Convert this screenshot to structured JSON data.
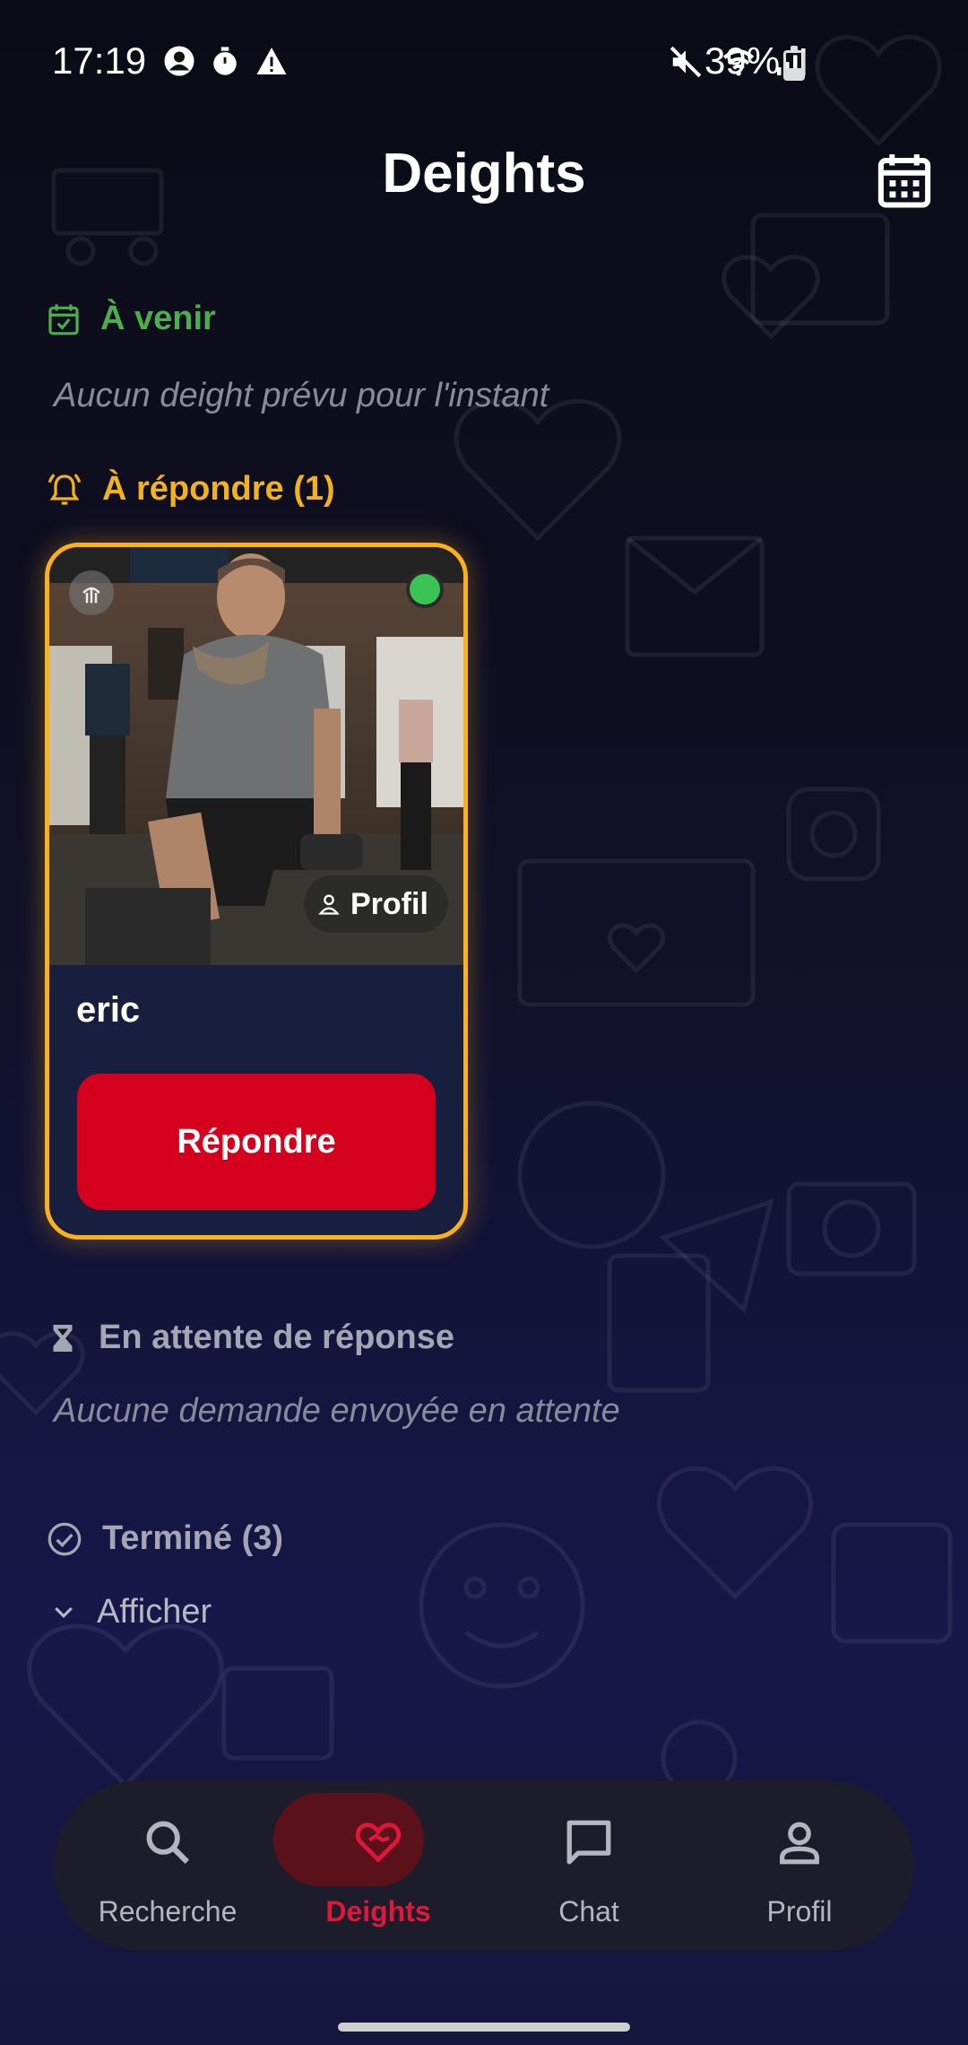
{
  "status_bar": {
    "time": "17:19",
    "battery": "39%",
    "battery_level": 0.39
  },
  "header": {
    "title": "Deights",
    "calendar_icon": "calendar-icon"
  },
  "sections": {
    "upcoming": {
      "title": "À venir",
      "empty_text": "Aucun deight prévu pour l'instant",
      "color": "#4cae4f",
      "icon": "calendar-check-icon"
    },
    "to_respond": {
      "title": "À répondre (1)",
      "color": "#f2b21c",
      "icon": "bell-icon",
      "cards": [
        {
          "name": "eric",
          "profile_label": "Profil",
          "reply_label": "Répondre",
          "online": true
        }
      ]
    },
    "waiting": {
      "title": "En attente de réponse",
      "empty_text": "Aucune demande envoyée en attente",
      "icon": "hourglass-icon"
    },
    "done": {
      "title": "Terminé (3)",
      "icon": "check-circle-icon",
      "toggle_label": "Afficher"
    }
  },
  "bottom_nav": {
    "items": [
      {
        "label": "Recherche",
        "icon": "search-icon",
        "active": false
      },
      {
        "label": "Deights",
        "icon": "heart-handshake-icon",
        "active": true
      },
      {
        "label": "Chat",
        "icon": "chat-icon",
        "active": false
      },
      {
        "label": "Profil",
        "icon": "person-icon",
        "active": false
      }
    ]
  },
  "colors": {
    "accent": "#d4001d",
    "card_border": "#fbb117",
    "online": "#39c454"
  }
}
